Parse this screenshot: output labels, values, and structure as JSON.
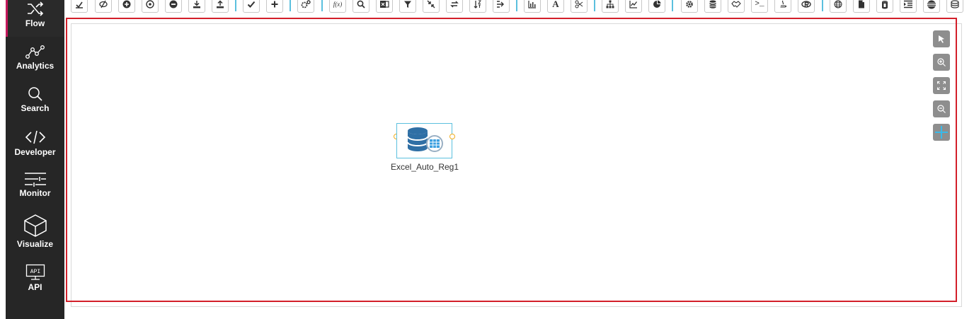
{
  "sidebar": {
    "items": [
      {
        "label": "Flow",
        "icon": "shuffle-icon",
        "active": true
      },
      {
        "label": "Analytics",
        "icon": "analytics-icon"
      },
      {
        "label": "Search",
        "icon": "search-icon"
      },
      {
        "label": "Developer",
        "icon": "code-icon"
      },
      {
        "label": "Monitor",
        "icon": "monitor-icon"
      },
      {
        "label": "Visualize",
        "icon": "cube-icon"
      },
      {
        "label": "API",
        "icon": "api-icon",
        "badge": "API"
      }
    ],
    "accent": "#c2185b"
  },
  "toolbar": {
    "glyphs": {
      "fx": "f(x)",
      "text": "A",
      "terminal": ">_"
    }
  },
  "canvas": {
    "node": {
      "label": "Excel_Auto_Reg1",
      "icon": "database-excel-icon"
    },
    "selection_color": "#d31f2a"
  }
}
